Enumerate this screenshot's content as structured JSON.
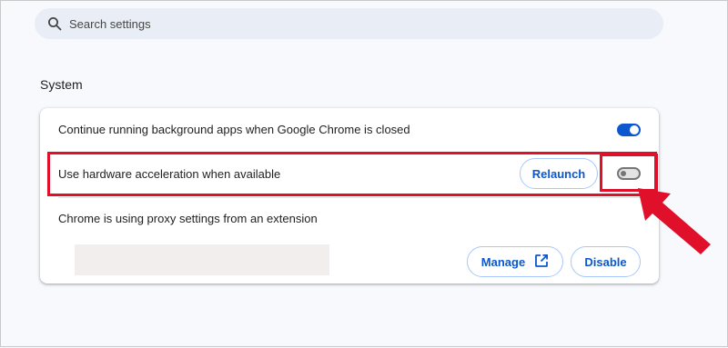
{
  "search": {
    "placeholder": "Search settings",
    "icon": "search-icon"
  },
  "section": {
    "title": "System"
  },
  "settings": {
    "background_apps": {
      "label": "Continue running background apps when Google Chrome is closed",
      "enabled": true
    },
    "hardware_acceleration": {
      "label": "Use hardware acceleration when available",
      "enabled": false,
      "relaunch_label": "Relaunch"
    },
    "proxy": {
      "label": "Chrome is using proxy settings from an extension",
      "manage_label": "Manage",
      "manage_icon": "open-in-new-icon",
      "disable_label": "Disable"
    }
  },
  "colors": {
    "accent": "#0b57d0",
    "highlight": "#e0102b",
    "search_background": "#e9eef6",
    "toggle_off": "#747775"
  }
}
